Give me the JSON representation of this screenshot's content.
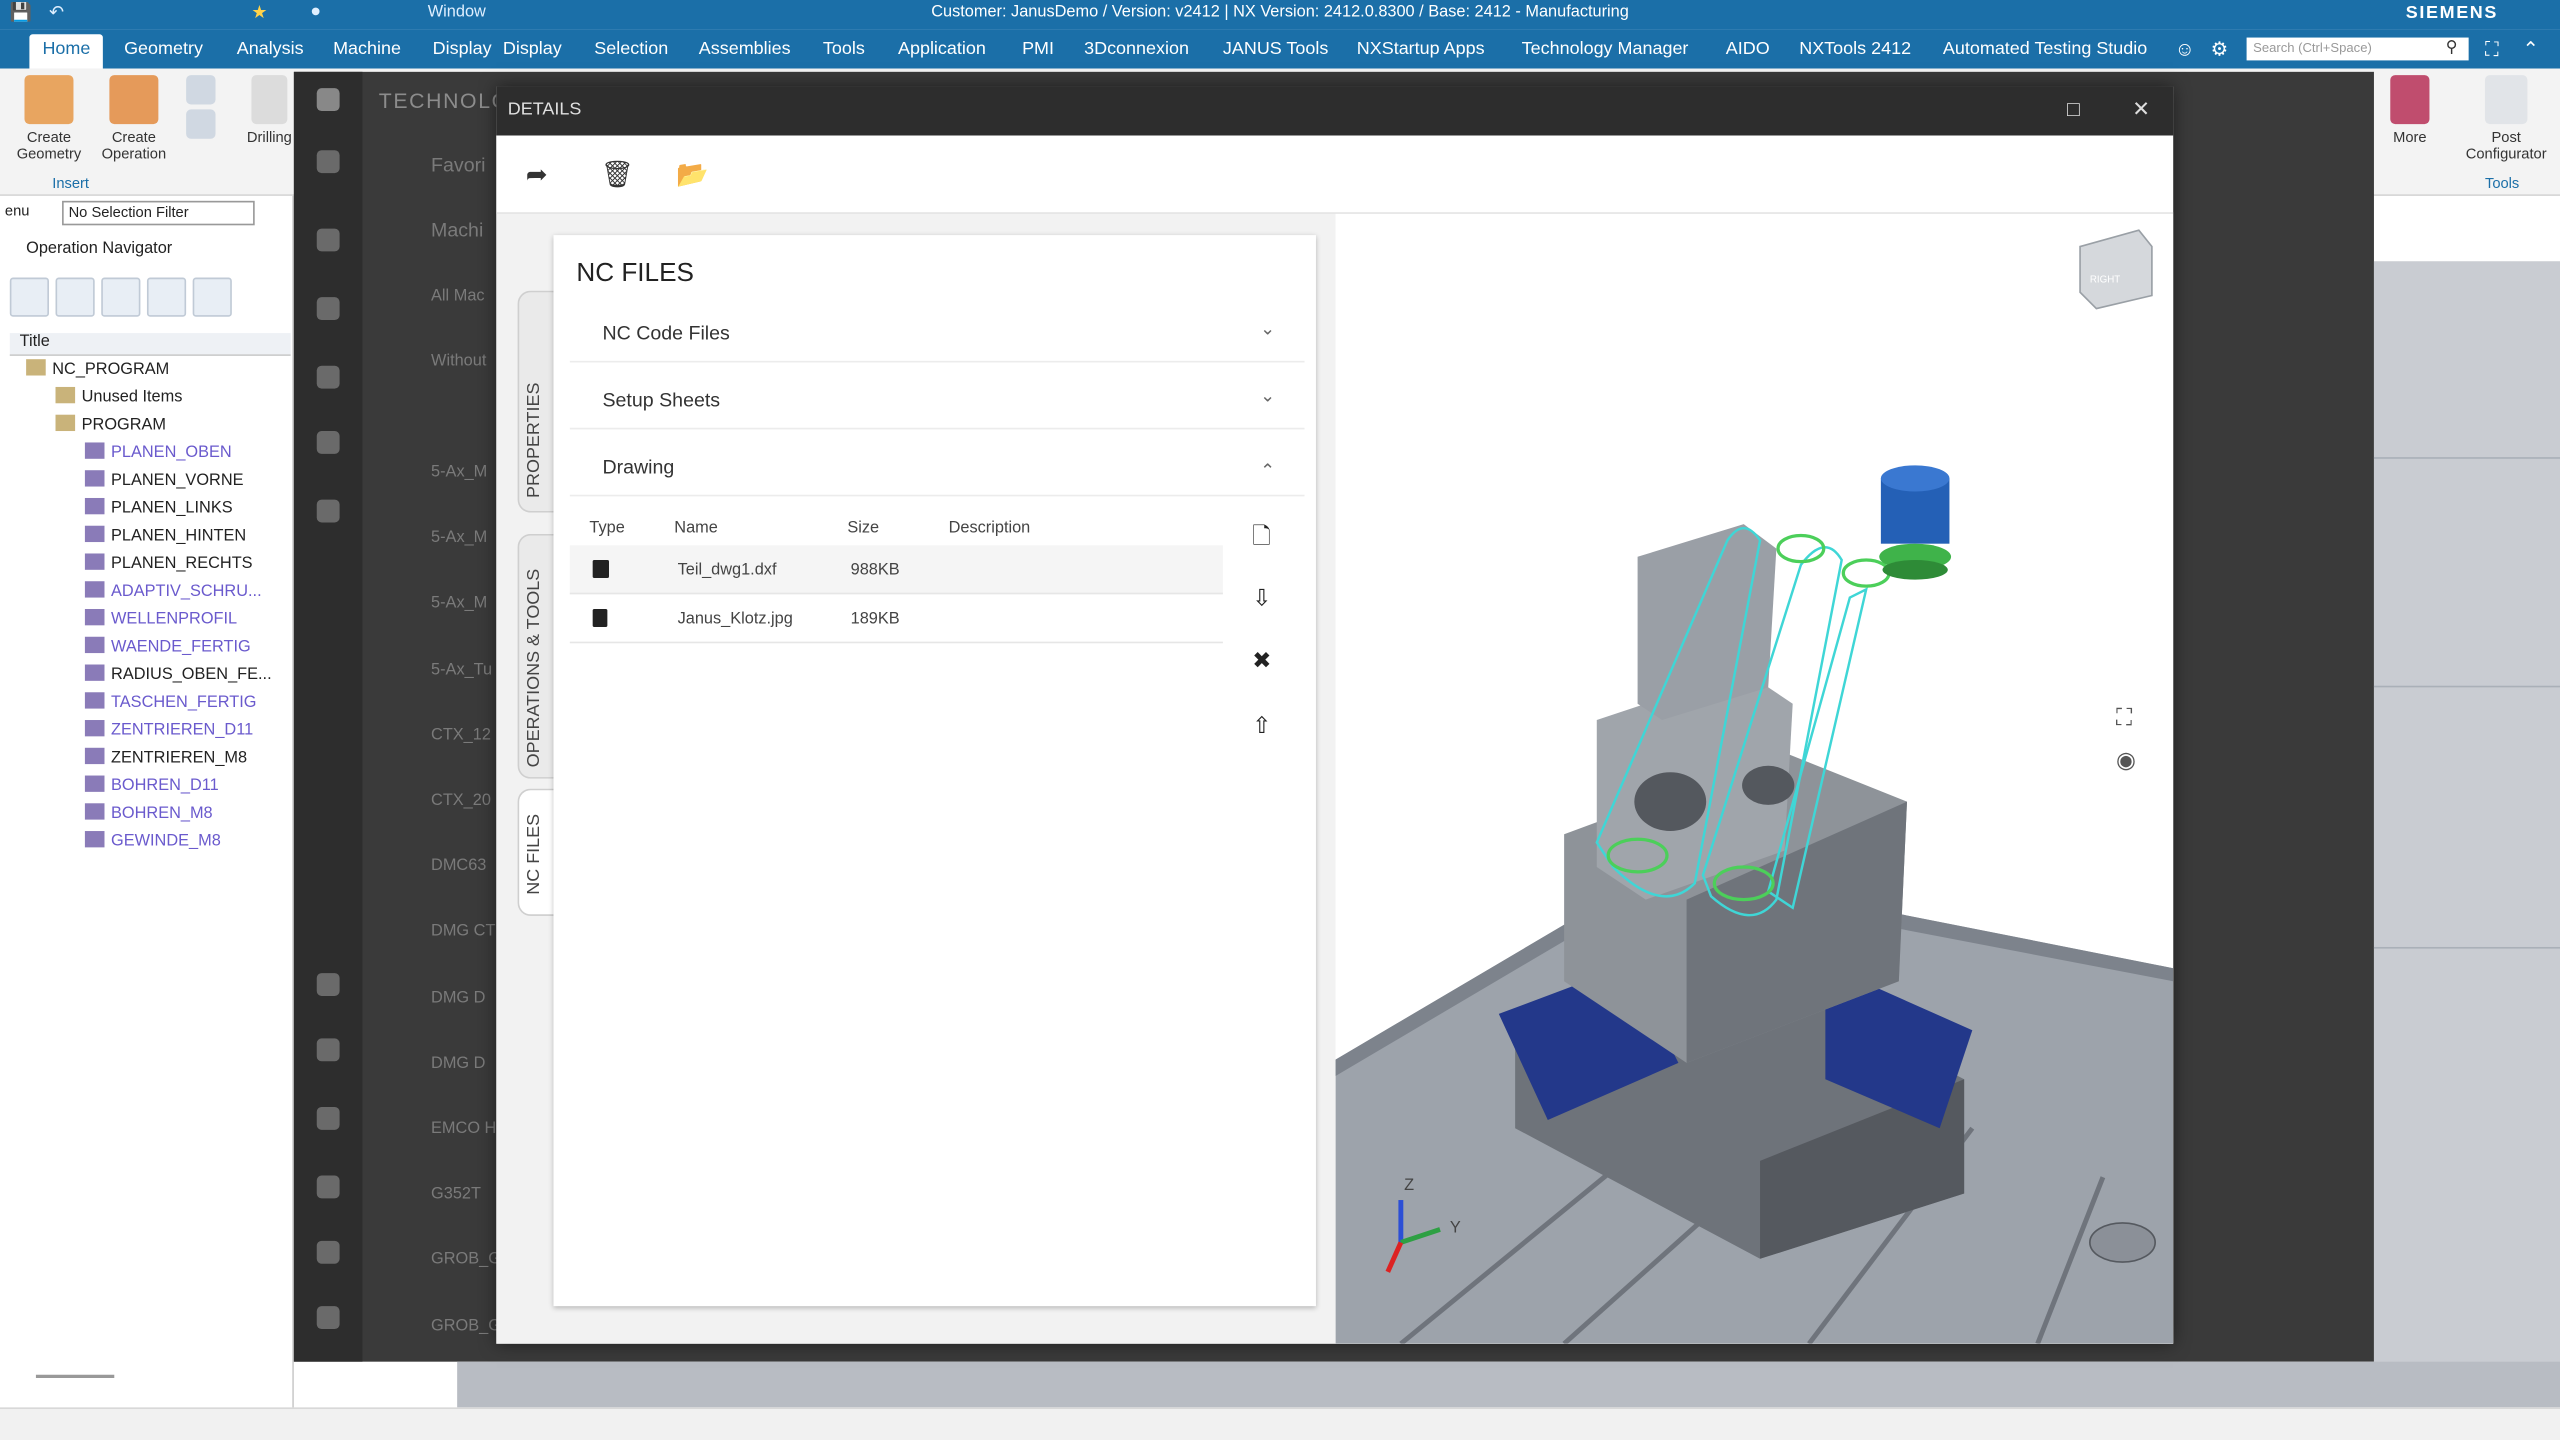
{
  "title_bar": {
    "title": "Customer: JanusDemo / Version: v2412 | NX Version: 2412.0.8300 / Base: 2412 - Manufacturing",
    "window_menu": "Window",
    "brand": "SIEMENS"
  },
  "menu": {
    "items": [
      "Home",
      "Geometry",
      "Analysis",
      "Machine",
      "Display",
      "Selection",
      "Assemblies",
      "Tools",
      "Application",
      "PMI",
      "3Dconnexion",
      "JANUS Tools",
      "NXStartup Apps",
      "Technology Manager",
      "AIDO",
      "NXTools 2412",
      "Automated Testing Studio"
    ],
    "active": "Home",
    "search_placeholder": "Search (Ctrl+Space)"
  },
  "ribbon": {
    "create_geometry": "Create Geometry",
    "create_operation": "Create Operation",
    "drilling": "Drilling",
    "insert_group": "Insert",
    "more": "More",
    "post_configurator": "Post Configurator",
    "tools_group": "Tools"
  },
  "left_nav": {
    "menu_label": "enu",
    "selection_filter": "No Selection Filter",
    "title": "Operation Navigator",
    "column_title": "Title",
    "nodes": [
      {
        "label": "NC_PROGRAM",
        "level": 0,
        "kind": "root"
      },
      {
        "label": "Unused Items",
        "level": 1,
        "kind": "folder"
      },
      {
        "label": "PROGRAM",
        "level": 1,
        "kind": "folder"
      },
      {
        "label": "PLANEN_OBEN",
        "level": 2,
        "kind": "op"
      },
      {
        "label": "PLANEN_VORNE",
        "level": 2,
        "kind": "op-dark"
      },
      {
        "label": "PLANEN_LINKS",
        "level": 2,
        "kind": "op-dark"
      },
      {
        "label": "PLANEN_HINTEN",
        "level": 2,
        "kind": "op-dark"
      },
      {
        "label": "PLANEN_RECHTS",
        "level": 2,
        "kind": "op-dark"
      },
      {
        "label": "ADAPTIV_SCHRU...",
        "level": 2,
        "kind": "op"
      },
      {
        "label": "WELLENPROFIL",
        "level": 2,
        "kind": "op"
      },
      {
        "label": "WAENDE_FERTIG",
        "level": 2,
        "kind": "op"
      },
      {
        "label": "RADIUS_OBEN_FE...",
        "level": 2,
        "kind": "op-dark"
      },
      {
        "label": "TASCHEN_FERTIG",
        "level": 2,
        "kind": "op"
      },
      {
        "label": "ZENTRIEREN_D11",
        "level": 2,
        "kind": "op"
      },
      {
        "label": "ZENTRIEREN_M8",
        "level": 2,
        "kind": "op-dark"
      },
      {
        "label": "BOHREN_D11",
        "level": 2,
        "kind": "op"
      },
      {
        "label": "BOHREN_M8",
        "level": 2,
        "kind": "op"
      },
      {
        "label": "GEWINDE_M8",
        "level": 2,
        "kind": "op"
      }
    ]
  },
  "background_app": {
    "header": "TECHNOLOGY MANAGER",
    "favorites": "Favori",
    "machines": "Machi",
    "all_machines": "All Mac",
    "without": "Without",
    "list": [
      "5-Ax_M",
      "5-Ax_M",
      "5-Ax_M",
      "5-Ax_Tu",
      "CTX_12",
      "CTX_20",
      "DMC63",
      "DMG CT",
      "DMG D",
      "DMG D",
      "EMCO H",
      "G352T",
      "GROB_G",
      "GROB_G"
    ]
  },
  "dialog": {
    "title": "DETAILS",
    "panel_title": "NC FILES",
    "vertical_tabs": [
      "PROPERTIES",
      "OPERATIONS & TOOLS",
      "NC FILES"
    ],
    "sections": [
      {
        "label": "NC Code Files",
        "expanded": false
      },
      {
        "label": "Setup Sheets",
        "expanded": false
      },
      {
        "label": "Drawing",
        "expanded": true
      }
    ],
    "table": {
      "headers": [
        "Type",
        "Name",
        "Size",
        "Description"
      ],
      "rows": [
        {
          "name": "Teil_dwg1.dxf",
          "size": "988KB",
          "description": ""
        },
        {
          "name": "Janus_Klotz.jpg",
          "size": "189KB",
          "description": ""
        }
      ]
    },
    "view_cube_label": "RIGHT",
    "axes": [
      "Z",
      "Y"
    ]
  },
  "colors": {
    "title_bar": "#1b6fa8",
    "dark_app": "#3a3a3a",
    "toolpath": "#3fd6d6",
    "fixture_blue": "#1f3a8a",
    "tool_blue": "#1f5fb3",
    "tool_green": "#3fb34a"
  }
}
